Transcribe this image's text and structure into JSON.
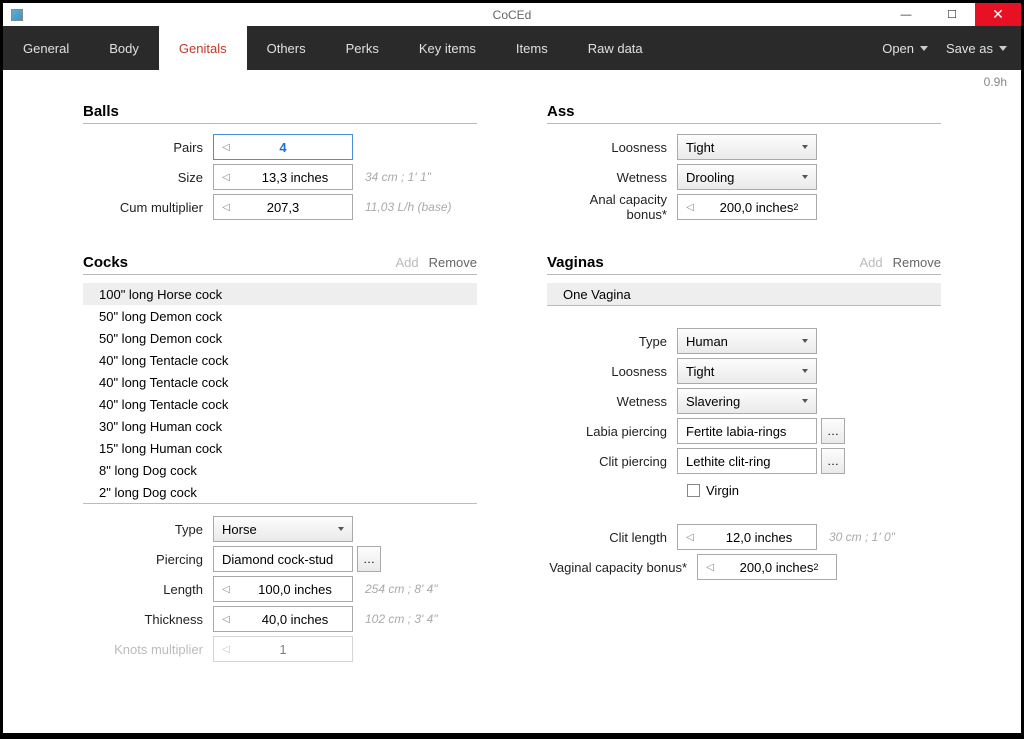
{
  "window": {
    "title": "CoCEd",
    "version": "0.9h"
  },
  "menubar": {
    "tabs": [
      "General",
      "Body",
      "Genitals",
      "Others",
      "Perks",
      "Key items",
      "Items",
      "Raw data"
    ],
    "active": 2,
    "open": "Open",
    "saveas": "Save as"
  },
  "balls": {
    "title": "Balls",
    "pairs": {
      "label": "Pairs",
      "value": "4"
    },
    "size": {
      "label": "Size",
      "value": "13,3 inches",
      "hint": "34 cm ; 1' 1\""
    },
    "cum": {
      "label": "Cum multiplier",
      "value": "207,3",
      "hint": "11,03 L/h (base)"
    }
  },
  "cocks": {
    "title": "Cocks",
    "actions": {
      "add": "Add",
      "remove": "Remove"
    },
    "items": [
      "100\" long Horse cock",
      "50\" long Demon cock",
      "50\" long Demon cock",
      "40\" long Tentacle cock",
      "40\" long Tentacle cock",
      "40\" long Tentacle cock",
      "30\" long Human cock",
      "15\" long Human cock",
      "8\" long Dog cock",
      "2\" long Dog cock"
    ],
    "type": {
      "label": "Type",
      "value": "Horse"
    },
    "piercing": {
      "label": "Piercing",
      "value": "Diamond cock-stud"
    },
    "length": {
      "label": "Length",
      "value": "100,0 inches",
      "hint": "254 cm ; 8' 4\""
    },
    "thickness": {
      "label": "Thickness",
      "value": "40,0 inches",
      "hint": "102 cm ; 3' 4\""
    },
    "knots": {
      "label": "Knots multiplier",
      "value": "1"
    }
  },
  "ass": {
    "title": "Ass",
    "loosness": {
      "label": "Loosness",
      "value": "Tight"
    },
    "wetness": {
      "label": "Wetness",
      "value": "Drooling"
    },
    "capacity": {
      "label": "Anal capacity bonus*",
      "value": "200,0 inches²"
    }
  },
  "vaginas": {
    "title": "Vaginas",
    "actions": {
      "add": "Add",
      "remove": "Remove"
    },
    "items": [
      "One Vagina"
    ],
    "type": {
      "label": "Type",
      "value": "Human"
    },
    "loosness": {
      "label": "Loosness",
      "value": "Tight"
    },
    "wetness": {
      "label": "Wetness",
      "value": "Slavering"
    },
    "labia": {
      "label": "Labia piercing",
      "value": "Fertite labia-rings"
    },
    "clitp": {
      "label": "Clit piercing",
      "value": "Lethite clit-ring"
    },
    "virgin": {
      "label": "Virgin"
    },
    "clitlen": {
      "label": "Clit length",
      "value": "12,0 inches",
      "hint": "30 cm ; 1' 0\""
    },
    "vcap": {
      "label": "Vaginal capacity bonus*",
      "value": "200,0 inches²"
    }
  }
}
